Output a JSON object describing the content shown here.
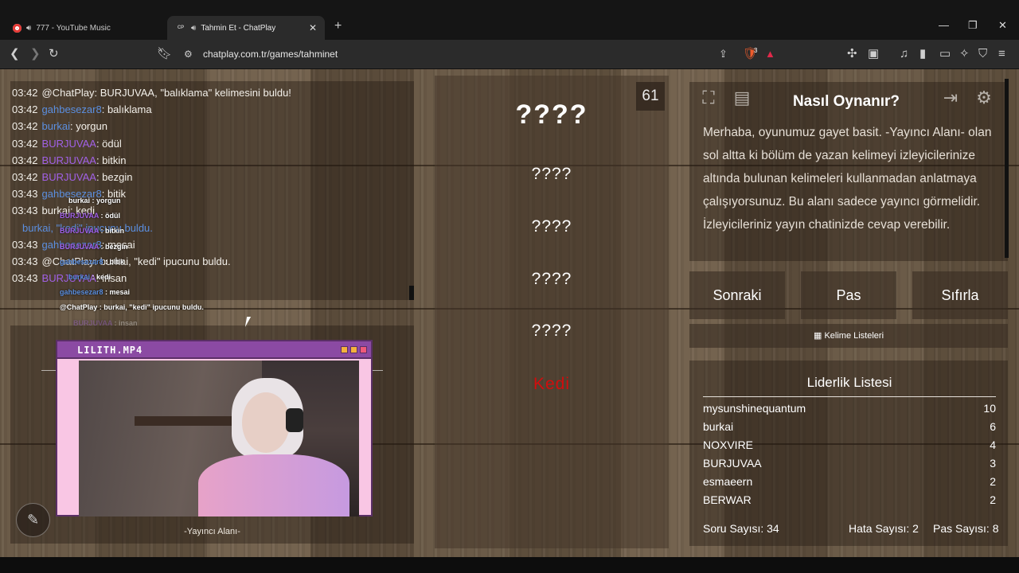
{
  "browser": {
    "tabs": [
      {
        "title": "777 - YouTube Music",
        "active": false,
        "favicon": "youtube-music-icon"
      },
      {
        "title": "Tahmin Et - ChatPlay",
        "active": true,
        "favicon": "chatplay-icon",
        "favicon_text": "CP"
      }
    ],
    "url": "chatplay.com.tr/games/tahminet",
    "extension_badge": "3"
  },
  "chat": {
    "lines": [
      {
        "time": "03:42",
        "user": "@ChatPlay",
        "user_color": "white",
        "msg": ": BURJUVAA, \"balıklama\" kelimesini buldu!"
      },
      {
        "time": "03:42",
        "user": "gahbesezar8",
        "user_color": "blue",
        "msg": ": balıklama"
      },
      {
        "time": "03:42",
        "user": "burkai",
        "user_color": "blue",
        "msg": ": yorgun"
      },
      {
        "time": "03:42",
        "user": "BURJUVAA",
        "user_color": "purple",
        "msg": ": ödül"
      },
      {
        "time": "03:42",
        "user": "BURJUVAA",
        "user_color": "purple",
        "msg": ": bitkin"
      },
      {
        "time": "03:42",
        "user": "BURJUVAA",
        "user_color": "purple",
        "msg": ": bezgin"
      },
      {
        "time": "03:43",
        "user": "gahbesezar8",
        "user_color": "blue",
        "msg": ": bitik"
      },
      {
        "time": "03:43",
        "user": "burkai",
        "user_color": "white",
        "msg": ": kedi"
      },
      {
        "time": "",
        "user": "burkai, \"kedi\" ipucunu buldu.",
        "user_color": "blue",
        "msg": ""
      },
      {
        "time": "03:43",
        "user": "gahbesezar8",
        "user_color": "blue",
        "msg": ": mesai"
      },
      {
        "time": "03:43",
        "user": "@ChatPlay",
        "user_color": "white",
        "msg": ": burkai, \"kedi\" ipucunu buldu."
      },
      {
        "time": "03:43",
        "user": "BURJUVAA",
        "user_color": "purple",
        "msg": ": insan"
      }
    ],
    "overlay": [
      {
        "user": "burkai",
        "msg": " : yorgun"
      },
      {
        "user": "BURJUVAA",
        "msg": " : ödül"
      },
      {
        "user": "BURJUVAA",
        "msg": " : bitkin"
      },
      {
        "user": "BURJUVAA",
        "msg": " : bezgin"
      },
      {
        "user": "gahbesezar8",
        "msg": " : bitik"
      },
      {
        "user": "burkai",
        "msg": " : kedi"
      },
      {
        "user": "gahbesezar8",
        "msg": " : mesai"
      },
      {
        "user": "@ChatPlay",
        "msg": " : burkai, \"kedi\" ipucunu buldu."
      },
      {
        "user": "BURJUVAA",
        "msg": " : insan"
      }
    ]
  },
  "stream": {
    "window_title": "LILITH.MP4",
    "caption": "-Yayıncı Alanı-"
  },
  "game": {
    "timer": "61",
    "main_word": "????",
    "hints": [
      "????",
      "????",
      "????",
      "????",
      "Kedi"
    ],
    "found_hint_color": "#d10d0d"
  },
  "howto": {
    "title": "Nasıl Oynanır?",
    "text": "Merhaba, oyunumuz gayet basit. -Yayıncı Alanı- olan sol altta ki bölüm de yazan kelimeyi izleyicilerinize altında bulunan kelimeleri kullanmadan anlatmaya çalışıyorsunuz. Bu alanı sadece yayıncı görmelidir. İzleyicileriniz yayın chatinizde cevap verebilir."
  },
  "controls": {
    "next": "Sonraki",
    "pass": "Pas",
    "reset": "Sıfırla",
    "word_lists": "Kelime Listeleri"
  },
  "leaderboard": {
    "title": "Liderlik Listesi",
    "rows": [
      {
        "name": "mysunshinequantum",
        "score": "10"
      },
      {
        "name": "burkai",
        "score": "6"
      },
      {
        "name": "NOXVIRE",
        "score": "4"
      },
      {
        "name": "BURJUVAA",
        "score": "3"
      },
      {
        "name": "esmaeern",
        "score": "2"
      },
      {
        "name": "BERWAR",
        "score": "2"
      }
    ],
    "question_count": "Soru Sayısı: 34",
    "error_count": "Hata Sayısı: 2",
    "pass_count": "Pas Sayısı: 8"
  }
}
